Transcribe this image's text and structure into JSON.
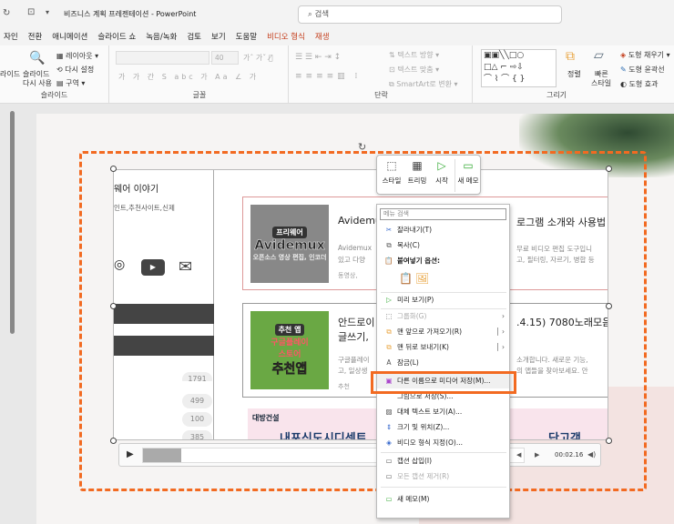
{
  "titlebar": {
    "title": "비즈니스 계획 프레젠테이션  -  PowerPoint",
    "search_placeholder": "검색"
  },
  "tabs": [
    "자인",
    "전환",
    "애니메이션",
    "슬라이드 쇼",
    "녹음/녹화",
    "검토",
    "보기",
    "도움말",
    "비디오 형식",
    "재생"
  ],
  "ribbon": {
    "slides": {
      "label": "슬라이드",
      "reuse1": "라이드",
      "reuse2": "슬라이드",
      "reuse3": "다시 사용",
      "layout": "레이아웃",
      "reset": "다시 설정",
      "section": "구역"
    },
    "font": {
      "label": "글꼴",
      "size": "40"
    },
    "paragraph": {
      "label": "단락",
      "text_direction": "텍스트 방향",
      "align_text": "텍스트 맞춤",
      "smartart": "SmartArt로 변환"
    },
    "drawing": {
      "label": "그리기",
      "arrange": "정렬",
      "quick1": "빠른",
      "quick2": "스타일",
      "fill": "도형 채우기",
      "outline": "도형 윤곽선",
      "effects": "도형 효과"
    }
  },
  "video": {
    "left_title": "웨어 이야기",
    "left_sub": "인트,추천사이트,신제",
    "counts": [
      "1791",
      "499",
      "100",
      "385"
    ],
    "card1": {
      "badge": "프리웨어",
      "brand": "Avidemux",
      "thumb_sub": "오픈소스 영상 편집, 인코더",
      "title": "Avidemux",
      "title_right": "로그램 소개와 사용법",
      "desc1": "Avidemux",
      "desc1_right": "무료 비디오 편집 도구입니",
      "desc2": "있고 다양",
      "desc2_right": "고, 필터링, 자르기, 병합 등",
      "tag": "동영상,"
    },
    "card2": {
      "badge": "추천 앱",
      "thumb_line1": "구글플레이",
      "thumb_line2": "스토어",
      "thumb_big": "추천앱",
      "title1": "안드로이",
      "title1_right": ".4.15) 7080노래모음",
      "title2": "글쓰기,",
      "desc1": "구글플레이",
      "desc1_right": "소개합니다. 새로운 기능,",
      "desc2": "고, 일상생",
      "desc2_right": "의 앱들을 찾아보세요. 안",
      "tag": "추천"
    },
    "ad_brand": "대방건설",
    "ad_text": "내포신도시디센트",
    "ad_right": "단고객",
    "time": "00:02.16"
  },
  "mini_toolbar": {
    "style": "스타일",
    "trim": "트리밍",
    "start": "시작",
    "new_comment": "새 메모"
  },
  "context_menu": {
    "search_placeholder": "메뉴 검색",
    "items": [
      "잘라내기(T)",
      "복사(C)",
      "붙여넣기 옵션:",
      "미리 보기(P)",
      "그룹화(G)",
      "맨 앞으로 가져오기(R)",
      "맨 뒤로 보내기(K)",
      "잠금(L)",
      "다른 이름으로 미디어 저장(M)...",
      "그림으로 저장(S)...",
      "대체 텍스트 보기(A)...",
      "크기 및 위치(Z)...",
      "비디오 형식 지정(O)...",
      "캡션 삽입(I)",
      "모든 캡션 제거(R)",
      "새 메모(M)"
    ]
  },
  "colors": {
    "accent": "#f26a21",
    "ppt_red": "#c43e1c"
  }
}
